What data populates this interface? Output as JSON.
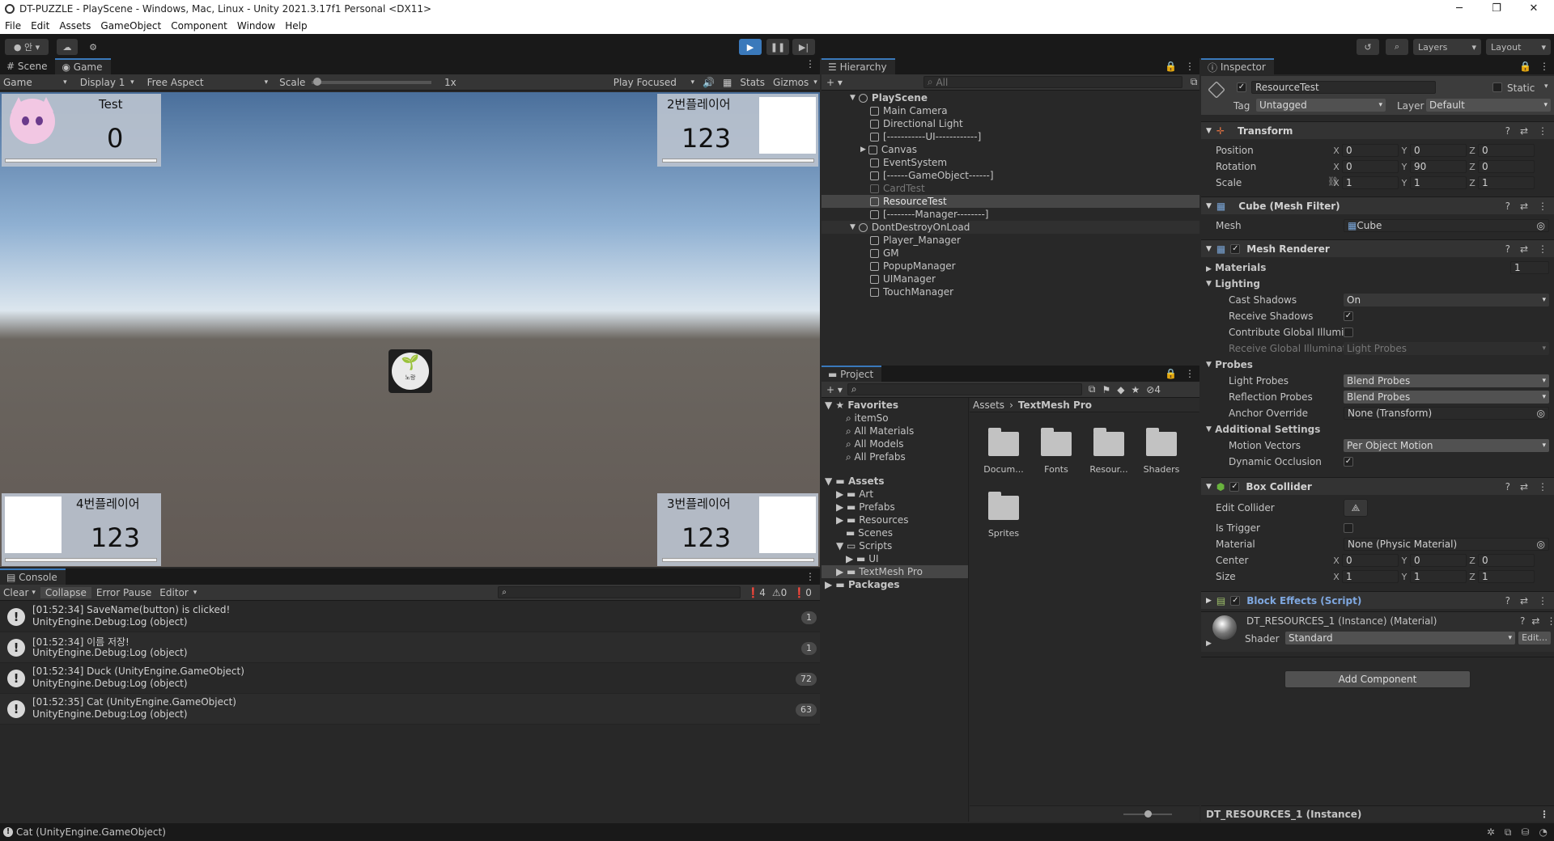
{
  "window": {
    "title": "DT-PUZZLE - PlayScene - Windows, Mac, Linux - Unity 2021.3.17f1 Personal <DX11>"
  },
  "menu": [
    "File",
    "Edit",
    "Assets",
    "GameObject",
    "Component",
    "Window",
    "Help"
  ],
  "toolbar": {
    "account": "안",
    "layers": "Layers",
    "layout": "Layout"
  },
  "game_view": {
    "tabs": [
      "Scene",
      "Game"
    ],
    "game_dropdown": "Game",
    "display": "Display 1",
    "aspect": "Free Aspect",
    "scale_label": "Scale",
    "scale_value": "1x",
    "play_focused": "Play Focused",
    "stats": "Stats",
    "gizmos": "Gizmos",
    "players": [
      {
        "name": "Test",
        "score": "0"
      },
      {
        "name": "2번플레이어",
        "score": "123"
      },
      {
        "name": "4번플레이어",
        "score": "123"
      },
      {
        "name": "3번플레이어",
        "score": "123"
      }
    ],
    "center_token_label": "노랑"
  },
  "hierarchy": {
    "title": "Hierarchy",
    "search_placeholder": "All",
    "items": [
      {
        "label": "PlayScene",
        "level": 0,
        "type": "scene",
        "expanded": true
      },
      {
        "label": "Main Camera",
        "level": 1
      },
      {
        "label": "Directional Light",
        "level": 1
      },
      {
        "label": "[-----------UI------------]",
        "level": 1
      },
      {
        "label": "Canvas",
        "level": 1,
        "collapsed": true
      },
      {
        "label": "EventSystem",
        "level": 1
      },
      {
        "label": "[------GameObject------]",
        "level": 1
      },
      {
        "label": "CardTest",
        "level": 1,
        "dim": true
      },
      {
        "label": "ResourceTest",
        "level": 1,
        "selected": true
      },
      {
        "label": "[--------Manager--------]",
        "level": 1
      },
      {
        "label": "DontDestroyOnLoad",
        "level": 0,
        "type": "scene",
        "expanded": true
      },
      {
        "label": "Player_Manager",
        "level": 1
      },
      {
        "label": "GM",
        "level": 1
      },
      {
        "label": "PopupManager",
        "level": 1
      },
      {
        "label": "UIManager",
        "level": 1
      },
      {
        "label": "TouchManager",
        "level": 1
      }
    ]
  },
  "project": {
    "title": "Project",
    "hidden_count": "4",
    "favorites_label": "Favorites",
    "favorites": [
      "itemSo",
      "All Materials",
      "All Models",
      "All Prefabs"
    ],
    "assets_label": "Assets",
    "asset_folders": [
      "Art",
      "Prefabs",
      "Resources",
      "Scenes",
      "Scripts"
    ],
    "scripts_children": [
      "UI"
    ],
    "selected_folder": "TextMesh Pro",
    "packages_label": "Packages",
    "breadcrumb": [
      "Assets",
      "TextMesh Pro"
    ],
    "grid": [
      "Docum...",
      "Fonts",
      "Resour...",
      "Shaders",
      "Sprites"
    ]
  },
  "console": {
    "title": "Console",
    "clear": "Clear",
    "collapse": "Collapse",
    "error_pause": "Error Pause",
    "editor": "Editor",
    "counts": {
      "log": "4",
      "warn": "0",
      "error": "0"
    },
    "entries": [
      {
        "line1": "[01:52:34] SaveName(button) is clicked!",
        "line2": "UnityEngine.Debug:Log (object)",
        "count": "1"
      },
      {
        "line1": "[01:52:34] 이름 저장!",
        "line2": "UnityEngine.Debug:Log (object)",
        "count": "1"
      },
      {
        "line1": "[01:52:34] Duck (UnityEngine.GameObject)",
        "line2": "UnityEngine.Debug:Log (object)",
        "count": "72"
      },
      {
        "line1": "[01:52:35] Cat (UnityEngine.GameObject)",
        "line2": "UnityEngine.Debug:Log (object)",
        "count": "63"
      }
    ]
  },
  "inspector": {
    "title": "Inspector",
    "object_name": "ResourceTest",
    "static_label": "Static",
    "tag_label": "Tag",
    "tag_value": "Untagged",
    "layer_label": "Layer",
    "layer_value": "Default",
    "transform": {
      "title": "Transform",
      "position_label": "Position",
      "position": [
        "0",
        "0",
        "0"
      ],
      "rotation_label": "Rotation",
      "rotation": [
        "0",
        "90",
        "0"
      ],
      "scale_label": "Scale",
      "scale": [
        "1",
        "1",
        "1"
      ]
    },
    "mesh_filter": {
      "title": "Cube (Mesh Filter)",
      "mesh_label": "Mesh",
      "mesh_value": "Cube"
    },
    "mesh_renderer": {
      "title": "Mesh Renderer",
      "materials_label": "Materials",
      "materials_count": "1",
      "lighting_label": "Lighting",
      "cast_shadows_label": "Cast Shadows",
      "cast_shadows": "On",
      "receive_shadows_label": "Receive Shadows",
      "contribute_gi_label": "Contribute Global Illumina",
      "receive_gi_label": "Receive Global Illuminatic",
      "receive_gi": "Light Probes",
      "probes_label": "Probes",
      "light_probes_label": "Light Probes",
      "light_probes": "Blend Probes",
      "reflection_probes_label": "Reflection Probes",
      "reflection_probes": "Blend Probes",
      "anchor_override_label": "Anchor Override",
      "anchor_override": "None (Transform)",
      "additional_label": "Additional Settings",
      "motion_vectors_label": "Motion Vectors",
      "motion_vectors": "Per Object Motion",
      "dynamic_occlusion_label": "Dynamic Occlusion"
    },
    "box_collider": {
      "title": "Box Collider",
      "edit_collider_label": "Edit Collider",
      "is_trigger_label": "Is Trigger",
      "material_label": "Material",
      "material_value": "None (Physic Material)",
      "center_label": "Center",
      "center": [
        "0",
        "0",
        "0"
      ],
      "size_label": "Size",
      "size": [
        "1",
        "1",
        "1"
      ]
    },
    "script": {
      "title": "Block Effects (Script)"
    },
    "material": {
      "name": "DT_RESOURCES_1 (Instance) (Material)",
      "shader_label": "Shader",
      "shader_value": "Standard",
      "edit": "Edit..."
    },
    "add_component": "Add Component",
    "footer": "DT_RESOURCES_1 (Instance)"
  },
  "status_bar": {
    "message": "Cat (UnityEngine.GameObject)"
  }
}
